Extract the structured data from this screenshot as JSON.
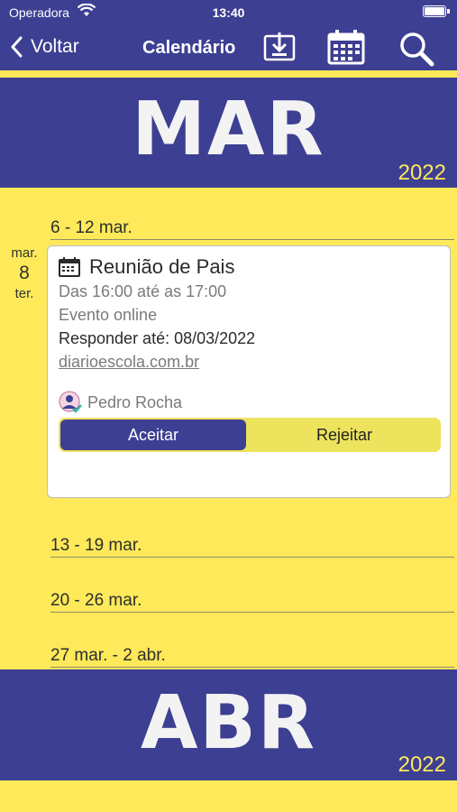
{
  "status_bar": {
    "carrier": "Operadora",
    "time": "13:40"
  },
  "nav": {
    "back_label": "Voltar",
    "title": "Calendário",
    "icons": [
      "download-icon",
      "calendar-icon",
      "search-icon"
    ]
  },
  "months": [
    {
      "name": "MAR",
      "year": "2022"
    },
    {
      "name": "ABR",
      "year": "2022"
    }
  ],
  "weeks": [
    "6 - 12 mar.",
    "13 - 19 mar.",
    "20 - 26 mar.",
    "27 mar. - 2 abr."
  ],
  "day": {
    "month": "mar.",
    "number": "8",
    "weekday": "ter."
  },
  "event": {
    "title": "Reunião de Pais",
    "time": "Das 16:00 até as 17:00",
    "location": "Evento online",
    "reply_by": "Responder até: 08/03/2022",
    "link": "diarioescola.com.br",
    "person": "Pedro Rocha",
    "accept_label": "Aceitar",
    "reject_label": "Rejeitar"
  },
  "colors": {
    "primary": "#3d3f93",
    "accent": "#fde95a"
  }
}
